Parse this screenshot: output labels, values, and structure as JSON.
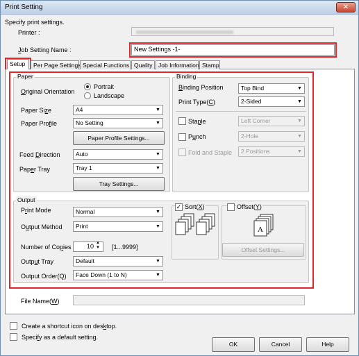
{
  "window": {
    "title": "Print Setting",
    "close": "✕"
  },
  "header": {
    "instruction": "Specify print settings.",
    "printer_label": "Printer :",
    "job_setting_label": "Job Setting Name :",
    "job_setting_value": "New Settings -1-"
  },
  "tabs": [
    {
      "label": "Setup"
    },
    {
      "label": "Per Page Settings"
    },
    {
      "label": "Special Functions"
    },
    {
      "label": "Quality"
    },
    {
      "label": "Job Information"
    },
    {
      "label": "Stamp"
    }
  ],
  "paper": {
    "group_title": "Paper",
    "orientation_label": "Original Orientation",
    "portrait": "Portrait",
    "landscape": "Landscape",
    "size_label": "Paper Size",
    "size_value": "A4",
    "profile_label": "Paper Profile",
    "profile_value": "No Setting",
    "profile_settings_button": "Paper Profile Settings...",
    "feed_label": "Feed Direction",
    "feed_value": "Auto",
    "tray_label": "Paper Tray",
    "tray_value": "Tray 1",
    "tray_settings_button": "Tray Settings..."
  },
  "binding": {
    "group_title": "Binding",
    "position_label": "Binding Position",
    "position_value": "Top Bind",
    "print_type_label": "Print Type(C)",
    "print_type_value": "2-Sided",
    "staple_label": "Staple",
    "staple_value": "Left Corner",
    "punch_label": "Punch",
    "punch_value": "2-Hole",
    "fold_label": "Fold and Staple",
    "fold_value": "2 Positions"
  },
  "output": {
    "group_title": "Output",
    "print_mode_label": "Print Mode",
    "print_mode_value": "Normal",
    "method_label": "Output Method",
    "method_value": "Print",
    "copies_label": "Number of Copies",
    "copies_value": "10",
    "copies_range": "[1...9999]",
    "tray_label": "Output Tray",
    "tray_value": "Default",
    "order_label": "Output Order(Q)",
    "order_value": "Face Down (1 to N)",
    "sort_label": "Sort(X)",
    "sort_checked": true,
    "offset_label": "Offset(Y)",
    "offset_checked": false,
    "offset_settings_button": "Offset Settings..."
  },
  "file_name_label": "File Name(W)",
  "bottom": {
    "shortcut_label": "Create a shortcut icon on desktop.",
    "default_label": "Specify as a default setting.",
    "ok": "OK",
    "cancel": "Cancel",
    "help": "Help"
  },
  "colors": {
    "highlight": "#e0262b"
  }
}
